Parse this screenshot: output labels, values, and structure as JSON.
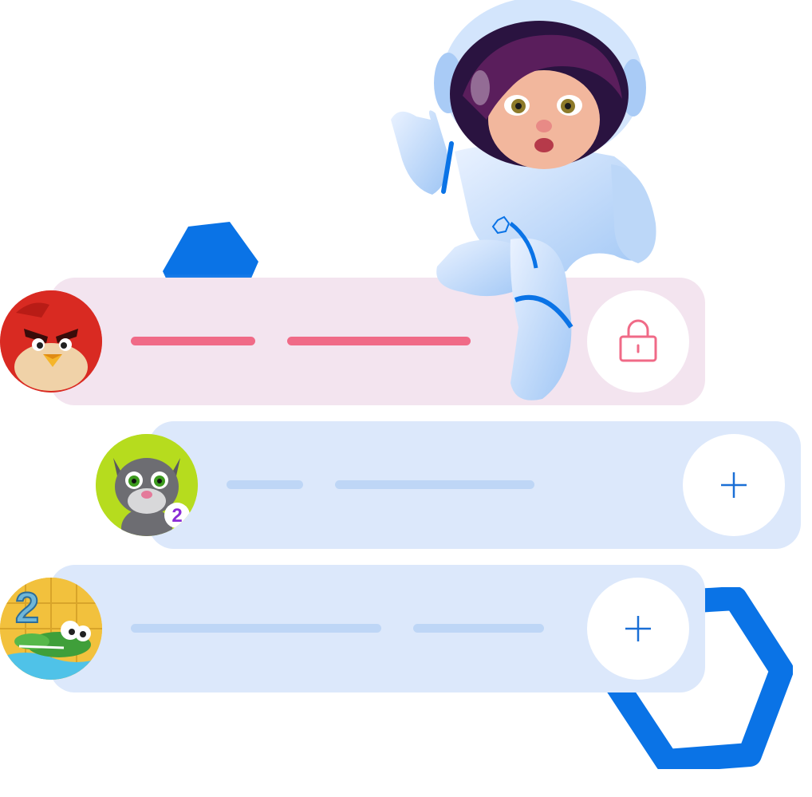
{
  "colors": {
    "accent_blue": "#0a73e6",
    "locked_row_bg": "#f3e4ef",
    "row_bg": "#dce8fb",
    "locked_bar": "#f06a87",
    "placeholder_bar": "#bed6f6",
    "lock_icon": "#f06a87",
    "plus_icon": "#1a6fd6"
  },
  "rows": [
    {
      "game": "angry-birds",
      "state": "locked",
      "action_icon": "lock-icon"
    },
    {
      "game": "talking-tom-2",
      "state": "available",
      "action_icon": "plus-icon",
      "badge": "2"
    },
    {
      "game": "wheres-my-water-2",
      "state": "available",
      "action_icon": "plus-icon",
      "badge": "2"
    }
  ],
  "mascot": "astronaut-girl-illustration"
}
